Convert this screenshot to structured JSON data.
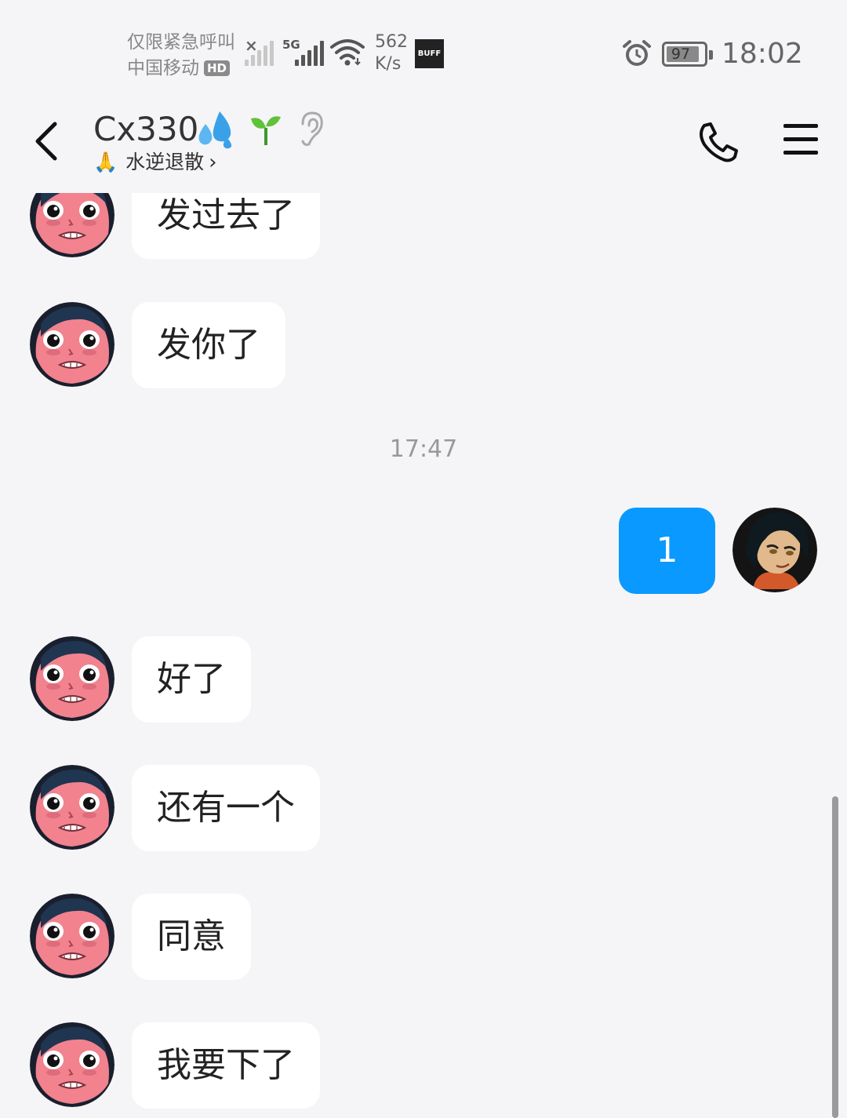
{
  "status_bar": {
    "carrier_line1": "仅限紧急呼叫",
    "carrier_line2": "中国移动",
    "hd_badge": "HD",
    "network_type": "5G",
    "speed_value": "562",
    "speed_unit": "K/s",
    "app_badge": "BUFF",
    "battery_level": "97",
    "time": "18:02"
  },
  "header": {
    "title": "Cx330.",
    "subtitle_emoji": "🙏",
    "subtitle": "水逆退散",
    "icons": [
      "back-icon",
      "droplets-icon",
      "sprout-icon",
      "ear-icon",
      "phone-icon",
      "menu-icon"
    ]
  },
  "messages": {
    "m1": "发过去了",
    "m2": "发你了",
    "timestamp": "17:47",
    "m3": "1",
    "m4": "好了",
    "m5": "还有一个",
    "m6": "同意",
    "m7": "我要下了"
  },
  "colors": {
    "background": "#f5f5f7",
    "outgoing_bubble": "#0a99ff",
    "incoming_bubble": "#ffffff"
  }
}
